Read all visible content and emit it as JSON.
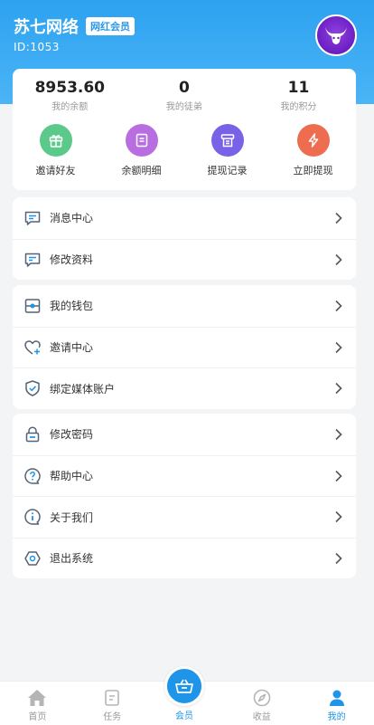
{
  "header": {
    "brand_name": "苏七网络",
    "vip_badge": "网红会员",
    "user_id": "ID:1053",
    "avatar_icon": "bull-head-icon"
  },
  "stats": [
    {
      "value": "8953.60",
      "label": "我的余额"
    },
    {
      "value": "0",
      "label": "我的徒弟"
    },
    {
      "value": "11",
      "label": "我的积分"
    }
  ],
  "actions": [
    {
      "label": "邀请好友",
      "icon": "gift-icon",
      "color": "#5bc98a"
    },
    {
      "label": "余额明细",
      "icon": "document-icon",
      "color": "#b86ee0"
    },
    {
      "label": "提现记录",
      "icon": "receipt-icon",
      "color": "#7a62e8"
    },
    {
      "label": "立即提现",
      "icon": "lightning-icon",
      "color": "#ee6d50"
    }
  ],
  "menu_group_1": [
    {
      "label": "消息中心",
      "icon": "message-icon"
    },
    {
      "label": "修改资料",
      "icon": "edit-message-icon"
    }
  ],
  "menu_group_2": [
    {
      "label": "我的钱包",
      "icon": "wallet-icon"
    },
    {
      "label": "邀请中心",
      "icon": "heart-plus-icon"
    },
    {
      "label": "绑定媒体账户",
      "icon": "shield-check-icon"
    }
  ],
  "menu_group_3": [
    {
      "label": "修改密码",
      "icon": "lock-icon"
    },
    {
      "label": "帮助中心",
      "icon": "question-icon"
    },
    {
      "label": "关于我们",
      "icon": "info-icon"
    },
    {
      "label": "退出系统",
      "icon": "hexagon-icon"
    }
  ],
  "tabbar": {
    "home": "首页",
    "task": "任务",
    "member": "会员",
    "income": "收益",
    "mine": "我的"
  },
  "colors": {
    "accent": "#1e95e8",
    "header_top": "#2da2f0",
    "icon_stroke": "#556377"
  }
}
